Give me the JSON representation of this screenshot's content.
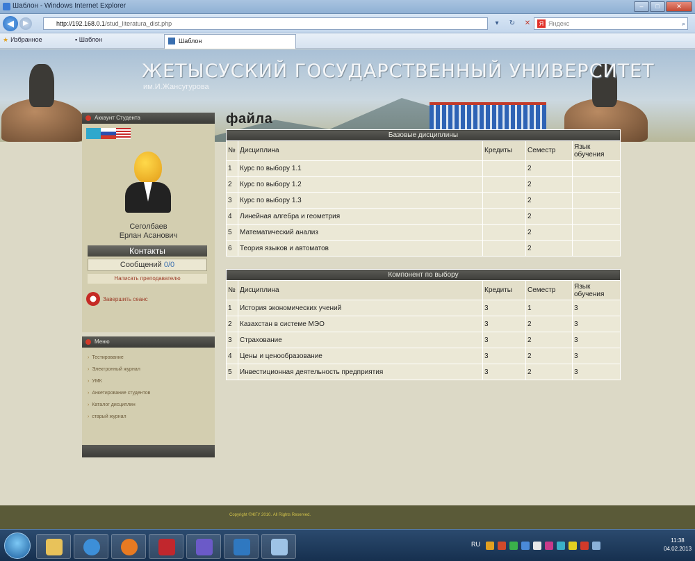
{
  "browser": {
    "title": "Шаблон - Windows Internet Explorer",
    "url_host": "http://192.168.0.1",
    "url_path": "/stud_literatura_dist.php",
    "search_placeholder": "Яндекс",
    "favorites_label": "Избранное",
    "fav_link": "Шаблон",
    "tab_label": "Шаблон"
  },
  "banner": {
    "title": "ЖЕТЫСУСКИЙ ГОСУДАРСТВЕННЫЙ УНИВЕРСИТЕТ",
    "subtitle": "им.И.Жансугурова"
  },
  "sidebar": {
    "account_header": "Аккаунт Студента",
    "student_name_line1": "Сеголбаев",
    "student_name_line2": "Ерлан Асанович",
    "contacts_label": "Контакты",
    "messages_label": "Сообщений",
    "messages_count": "0/0",
    "write_teacher_label": "Написать преподавателю",
    "logout_label": "Завершить сеанс",
    "menu_header": "Меню",
    "menu_items": [
      "Тестирование",
      "Электронный журнал",
      "УМК",
      "Анкетирование студентов",
      "Каталог дисциплин",
      "старый журнал"
    ]
  },
  "main": {
    "heading": "файла",
    "table1": {
      "caption": "Базовые дисциплины",
      "headers": [
        "№",
        "Дисциплина",
        "Кредиты",
        "Семестр",
        "Язык обучения"
      ],
      "rows": [
        [
          "1",
          "Курс по выбору 1.1",
          "",
          "2",
          ""
        ],
        [
          "2",
          "Курс по выбору 1.2",
          "",
          "2",
          ""
        ],
        [
          "3",
          "Курс по выбору 1.3",
          "",
          "2",
          ""
        ],
        [
          "4",
          "Линейная алгебра и геометрия",
          "",
          "2",
          ""
        ],
        [
          "5",
          "Математический анализ",
          "",
          "2",
          ""
        ],
        [
          "6",
          "Теория языков и автоматов",
          "",
          "2",
          ""
        ]
      ]
    },
    "table2": {
      "caption": "Компонент по выбору",
      "headers": [
        "№",
        "Дисциплина",
        "Кредиты",
        "Семестр",
        "Язык обучения"
      ],
      "rows": [
        [
          "1",
          "История экономических учений",
          "3",
          "1",
          "3"
        ],
        [
          "2",
          "Казахстан в системе МЭО",
          "3",
          "2",
          "3"
        ],
        [
          "3",
          "Страхование",
          "3",
          "2",
          "3"
        ],
        [
          "4",
          "Цены и ценообразование",
          "3",
          "2",
          "3"
        ],
        [
          "5",
          "Инвестиционная деятельность предприятия",
          "3",
          "2",
          "3"
        ]
      ]
    }
  },
  "footer": {
    "copyright": "Copyright ©ЖГУ 2010. All Rights Reserved."
  },
  "taskbar": {
    "lang": "RU",
    "time": "11:38",
    "date": "04.02.2013"
  },
  "colors": {
    "header_dark": "#3c3c38",
    "page_bg": "#dcd9c6",
    "cell_bg": "#ebe8d6",
    "accent_red": "#c52a25"
  }
}
